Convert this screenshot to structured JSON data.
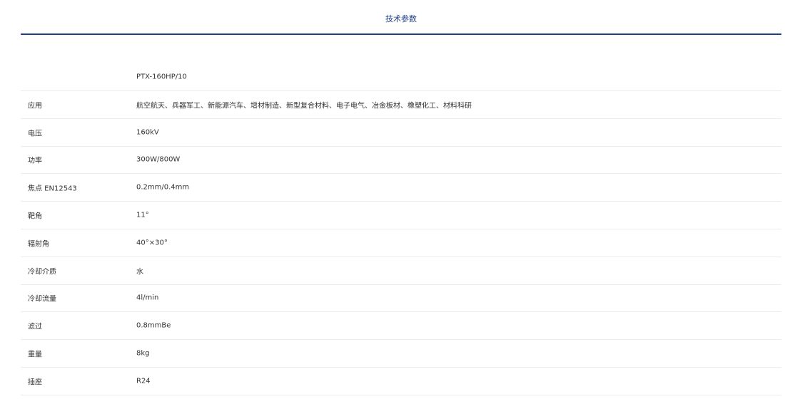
{
  "tab": {
    "title": "技术参数"
  },
  "model": "PTX-160HP/10",
  "specs": [
    {
      "label": "应用",
      "value": "航空航天、兵器军工、新能源汽车、增材制造、新型复合材料、电子电气、冶金板材、橡塑化工、材料科研"
    },
    {
      "label": "电压",
      "value": "160kV"
    },
    {
      "label": "功率",
      "value": "300W/800W"
    },
    {
      "label": "焦点 EN12543",
      "value": "0.2mm/0.4mm"
    },
    {
      "label": "靶角",
      "value": "11°"
    },
    {
      "label": "辐射角",
      "value": "40°×30°"
    },
    {
      "label": "冷却介质",
      "value": "水"
    },
    {
      "label": "冷却流量",
      "value": "4l/min"
    },
    {
      "label": "滤过",
      "value": "0.8mmBe"
    },
    {
      "label": "重量",
      "value": "8kg"
    },
    {
      "label": "插座",
      "value": "R24"
    }
  ],
  "colors": {
    "accent": "#1f3f86",
    "text": "#333333",
    "divider": "#ececec"
  }
}
